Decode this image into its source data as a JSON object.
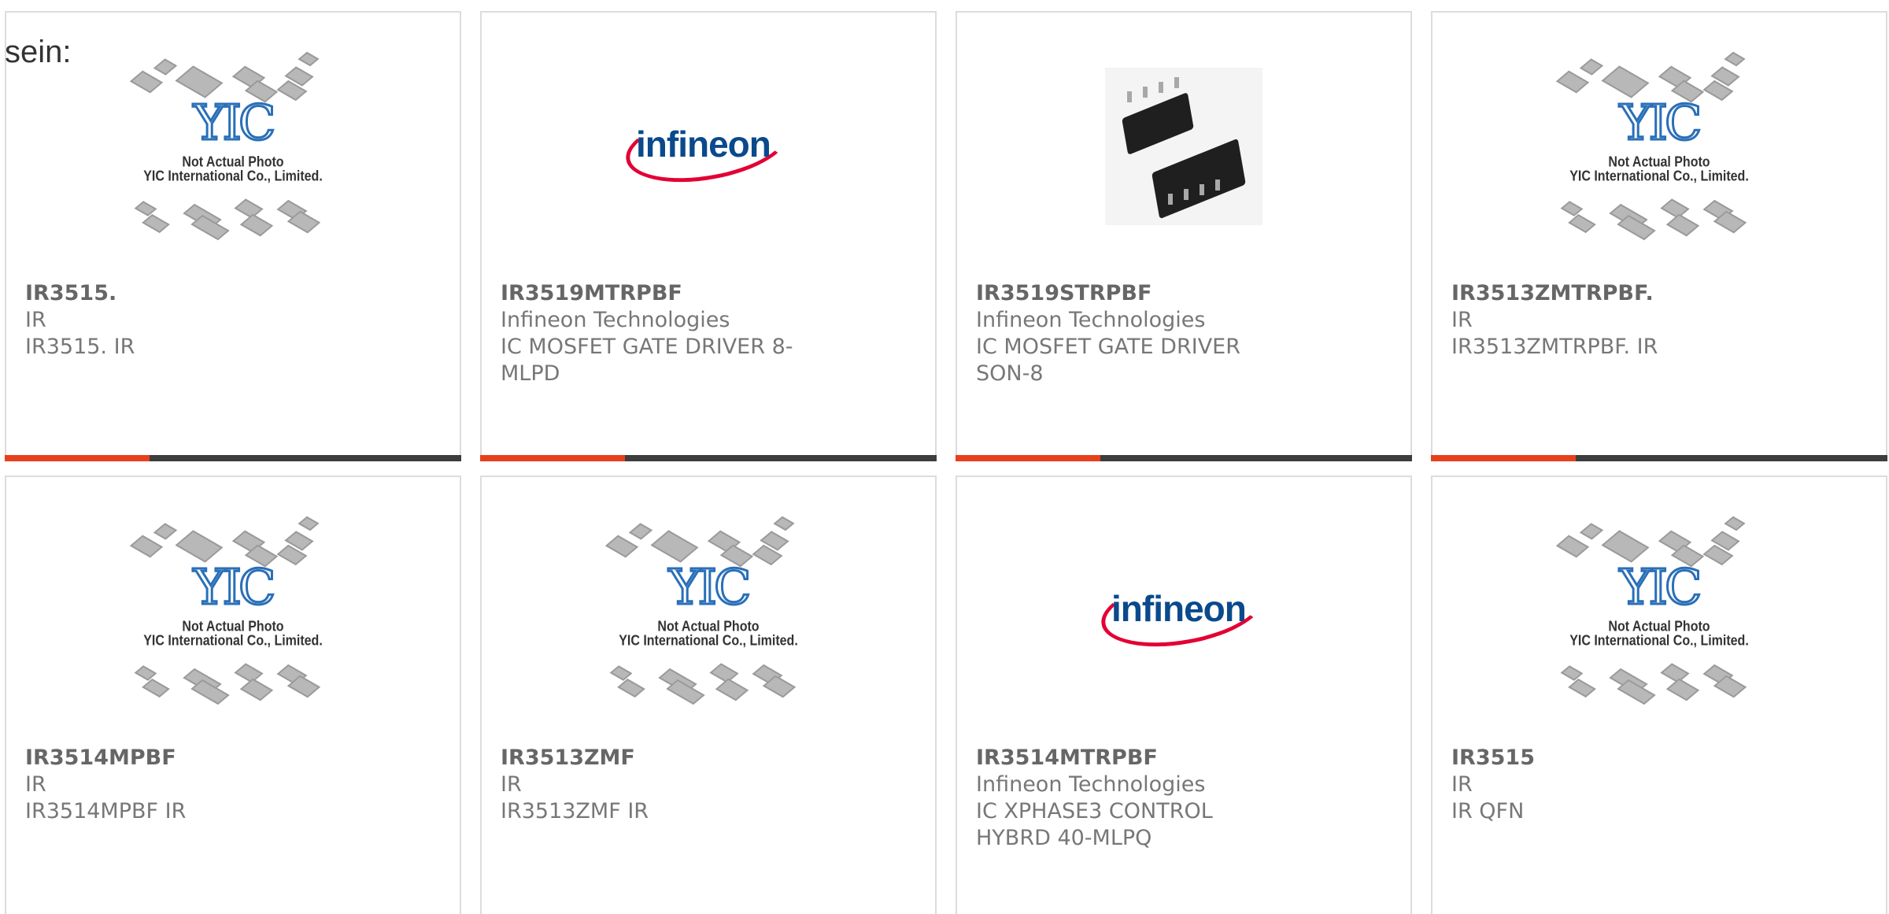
{
  "intro_text": "sein:",
  "placeholder": {
    "logo_text": "YIC",
    "line1": "Not Actual Photo",
    "line2": "YIC International Co., Limited."
  },
  "brand_logo_text": "infineon",
  "colors": {
    "accent": "#e8401c",
    "bar": "#3d3d3d",
    "border": "#dcdcdc",
    "text": "#666666",
    "yic_blue": "#2a6fb8",
    "infineon_red": "#e30034",
    "infineon_blue": "#0a4a8c"
  },
  "products": [
    {
      "part": "IR3515.",
      "manufacturer": "IR",
      "description": "IR3515. IR",
      "image": "yic-placeholder-icon"
    },
    {
      "part": "IR3519MTRPBF",
      "manufacturer": "Infineon Technologies",
      "description": "IC MOSFET GATE DRIVER 8-MLPD",
      "image": "infineon-logo-icon"
    },
    {
      "part": "IR3519STRPBF",
      "manufacturer": "Infineon Technologies",
      "description": "IC MOSFET GATE DRIVER SON-8",
      "image": "soic8-chip-photo"
    },
    {
      "part": "IR3513ZMTRPBF.",
      "manufacturer": "IR",
      "description": "IR3513ZMTRPBF. IR",
      "image": "yic-placeholder-icon"
    },
    {
      "part": "IR3514MPBF",
      "manufacturer": "IR",
      "description": "IR3514MPBF IR",
      "image": "yic-placeholder-icon"
    },
    {
      "part": "IR3513ZMF",
      "manufacturer": "IR",
      "description": "IR3513ZMF IR",
      "image": "yic-placeholder-icon"
    },
    {
      "part": "IR3514MTRPBF",
      "manufacturer": "Infineon Technologies",
      "description": "IC XPHASE3 CONTROL HYBRD 40-MLPQ",
      "image": "infineon-logo-icon"
    },
    {
      "part": "IR3515",
      "manufacturer": "IR",
      "description": "IR QFN",
      "image": "yic-placeholder-icon"
    }
  ]
}
